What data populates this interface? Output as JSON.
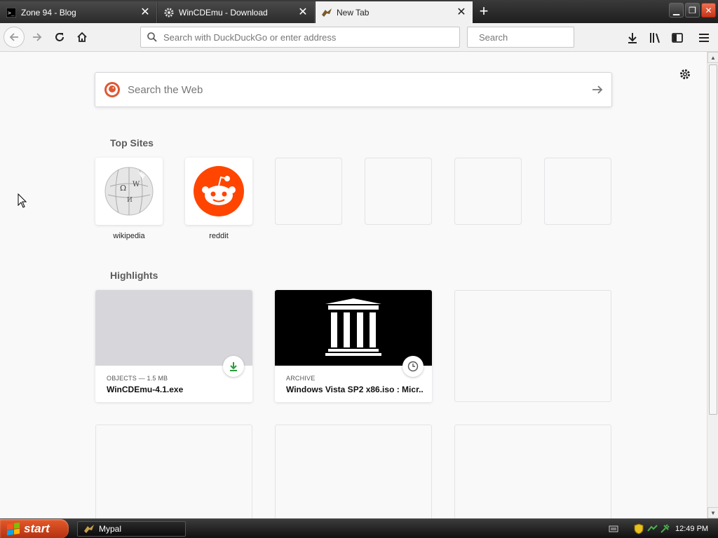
{
  "tabs": [
    {
      "title": "Zone 94 - Blog",
      "icon": "terminal-favicon",
      "active": false
    },
    {
      "title": "WinCDEmu - Download",
      "icon": "gear-favicon",
      "active": false
    },
    {
      "title": "New Tab",
      "icon": "mypal-favicon",
      "active": true
    }
  ],
  "navbar": {
    "url_placeholder": "Search with DuckDuckGo or enter address",
    "search_placeholder": "Search"
  },
  "websearch": {
    "placeholder": "Search the Web"
  },
  "top_sites": {
    "title": "Top Sites",
    "items": [
      {
        "label": "wikipedia"
      },
      {
        "label": "reddit"
      },
      {
        "label": ""
      },
      {
        "label": ""
      },
      {
        "label": ""
      },
      {
        "label": ""
      }
    ]
  },
  "highlights": {
    "title": "Highlights",
    "cards": [
      {
        "meta": "OBJECTS — 1.5 MB",
        "title": "WinCDEmu-4.1.exe",
        "badge": "download-icon"
      },
      {
        "meta": "ARCHIVE",
        "title": "Windows Vista SP2 x86.iso : Micr...",
        "badge": "clock-icon"
      }
    ]
  },
  "taskbar": {
    "start_label": "start",
    "task_label": "Mypal",
    "clock": "12:49 PM"
  },
  "colors": {
    "download_green": "#2a9d3a",
    "reddit_orange": "#ff4500",
    "start_orange": "#d9491c"
  }
}
